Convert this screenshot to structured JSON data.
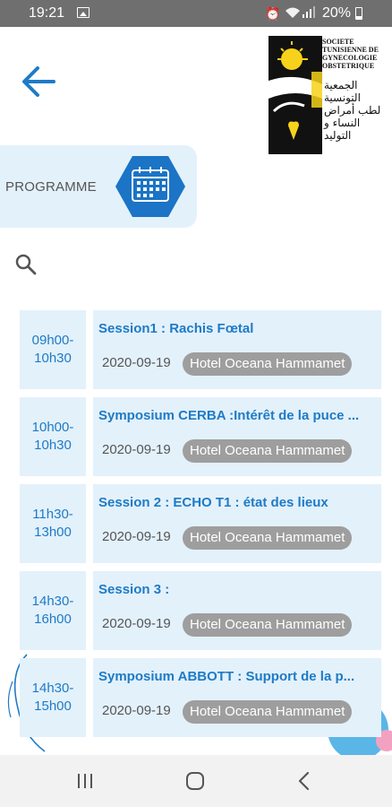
{
  "status_bar": {
    "time": "19:21",
    "battery": "20%"
  },
  "header": {
    "logo_text": "SOCIETE TUNISIENNE DE GYNECOLOGIE OBSTETRIQUE",
    "logo_arabic": "الجمعية التونسية لطب أمراض النساء و التوليد"
  },
  "programme": {
    "label": "PROGRAMME",
    "icon": "calendar-grid-icon"
  },
  "sessions": [
    {
      "start": "09h00-",
      "end": "10h30",
      "title": "Session1 : Rachis Fœtal",
      "date": "2020-09-19",
      "place": "Hotel Oceana Hammamet"
    },
    {
      "start": "10h00-",
      "end": "10h30",
      "title": "Symposium CERBA :Intérêt de la puce ...",
      "date": "2020-09-19",
      "place": "Hotel Oceana Hammamet"
    },
    {
      "start": "11h30-",
      "end": "13h00",
      "title": "Session 2 : ECHO T1 : état des lieux",
      "date": "2020-09-19",
      "place": "Hotel Oceana Hammamet"
    },
    {
      "start": "14h30-",
      "end": "16h00",
      "title": "Session 3 :",
      "date": "2020-09-19",
      "place": "Hotel Oceana Hammamet"
    },
    {
      "start": "14h30-",
      "end": "15h00",
      "title": "Symposium ABBOTT : Support de la p...",
      "date": "2020-09-19",
      "place": "Hotel Oceana Hammamet"
    }
  ],
  "colors": {
    "accent": "#1e7bc6",
    "card_bg": "#e3f1fb",
    "hex_icon": "#1b74c5",
    "badge": "#9e9e9e"
  }
}
